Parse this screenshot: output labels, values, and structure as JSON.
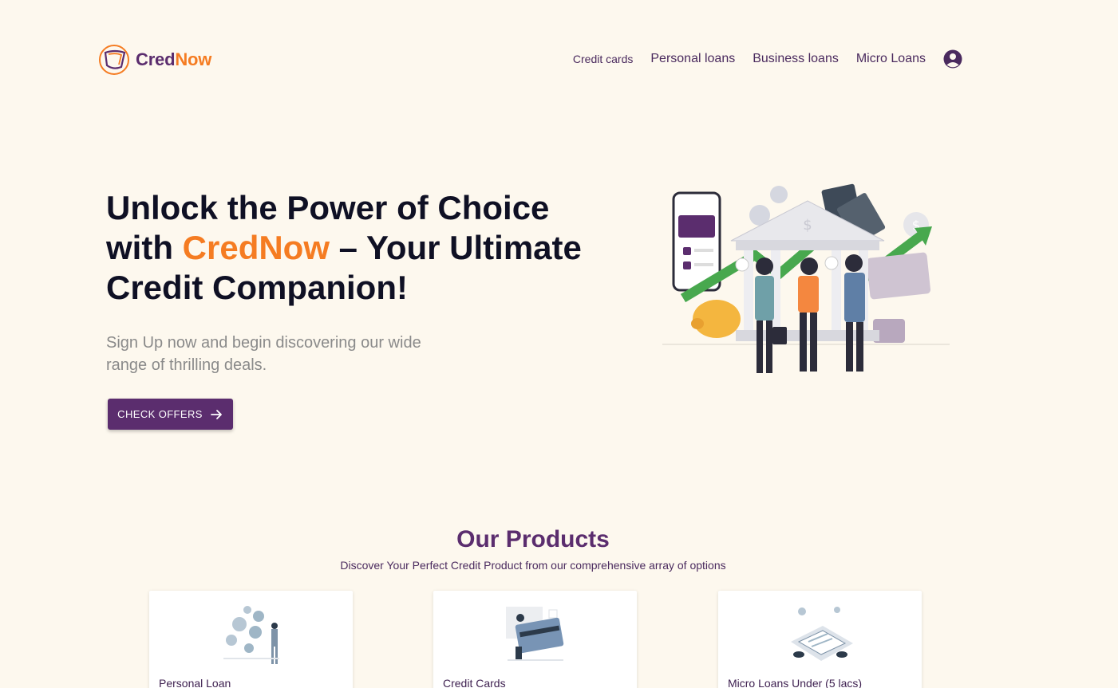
{
  "brand": {
    "name_part1": "Cred",
    "name_part2": "Now"
  },
  "nav": {
    "items": [
      "Credit cards",
      "Personal loans",
      "Business loans",
      "Micro Loans"
    ],
    "user_icon": "user-circle-icon"
  },
  "hero": {
    "title_line1": "Unlock the Power of Choice",
    "title_with": "with ",
    "title_brand": "CredNow",
    "title_dash": " – ",
    "title_bold": "Your Ultimate Credit Companion!",
    "subtitle": "Sign Up now and begin discovering our wide range of thrilling deals.",
    "cta_label": "CHECK OFFERS"
  },
  "products": {
    "title": "Our Products",
    "subtitle": "Discover Your Perfect Credit Product from our comprehensive array of options",
    "cards": [
      {
        "label": "Personal Loan"
      },
      {
        "label": "Credit Cards"
      },
      {
        "label": "Micro Loans Under (5 lacs)"
      }
    ]
  },
  "colors": {
    "brand_purple": "#5b2d6e",
    "brand_orange": "#f57c22",
    "background": "#fdf8ee"
  }
}
